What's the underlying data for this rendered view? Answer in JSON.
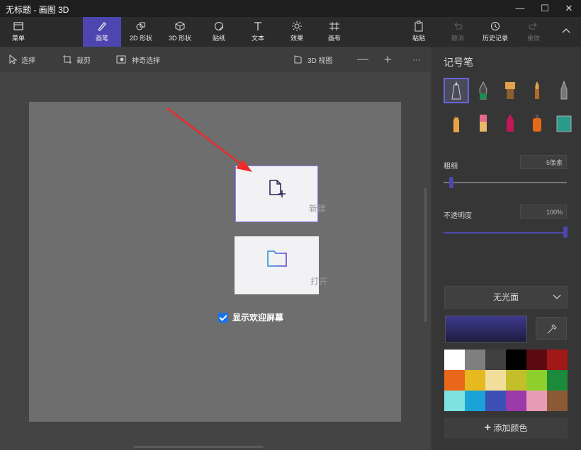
{
  "window": {
    "title": "无标题 - 画图 3D",
    "minimize": "—",
    "maximize": "☐",
    "close": "✕"
  },
  "ribbon": {
    "menu_label": "菜单",
    "tabs": [
      {
        "label": "画笔",
        "icon": "brush-icon"
      },
      {
        "label": "2D 形状",
        "icon": "2d-shapes-icon"
      },
      {
        "label": "3D 形状",
        "icon": "3d-shapes-icon"
      },
      {
        "label": "贴纸",
        "icon": "sticker-icon"
      },
      {
        "label": "文本",
        "icon": "text-icon"
      },
      {
        "label": "效果",
        "icon": "effects-icon"
      },
      {
        "label": "画布",
        "icon": "canvas-icon"
      }
    ],
    "paste_label": "粘贴",
    "undo_label": "撤消",
    "history_label": "历史记录",
    "redo_label": "重做"
  },
  "toolbar": {
    "select_label": "选择",
    "crop_label": "裁剪",
    "magic_select_label": "神奇选择",
    "view3d_label": "3D 视图",
    "zoom_out": "—",
    "zoom_in": "+",
    "more": "···"
  },
  "welcome": {
    "new_label": "新建",
    "open_label": "打开",
    "show_welcome_label": "显示欢迎屏幕",
    "show_welcome_checked": true
  },
  "panel": {
    "title": "记号笔",
    "thickness_label": "粗细",
    "thickness_value": "5像素",
    "opacity_label": "不透明度",
    "opacity_value": "100%",
    "finish_value": "无光面",
    "add_color_label": "添加颜色",
    "selected_color": "#3d3a8f",
    "palette": [
      "#ffffff",
      "#7f7f7f",
      "#3f3f3f",
      "#000000",
      "#5c0a12",
      "#a01818",
      "#e8671a",
      "#e6b91f",
      "#f1de9b",
      "#c2bf2b",
      "#8fcf2b",
      "#1b8a3a",
      "#7ee3e0",
      "#1aa3d6",
      "#3c4fb5",
      "#9b3aa8",
      "#e79bb5",
      "#8a5a36"
    ]
  }
}
